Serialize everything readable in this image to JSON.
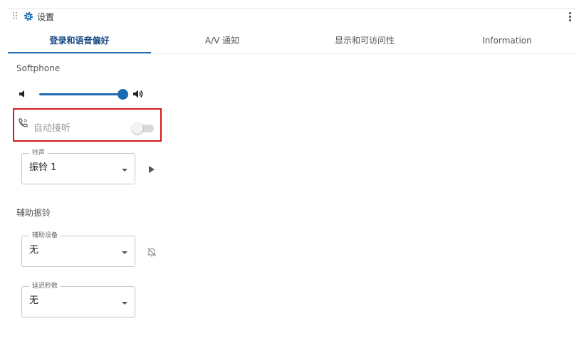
{
  "header": {
    "title": "设置",
    "more_icon": "more-vertical-icon",
    "drag_icon": "drag-handle-icon",
    "settings_icon": "gear-icon"
  },
  "tabs": [
    {
      "label": "登录和语音偏好",
      "active": true
    },
    {
      "label": "A/V 通知",
      "active": false
    },
    {
      "label": "显示和可访问性",
      "active": false
    },
    {
      "label": "Information",
      "active": false
    }
  ],
  "softphone": {
    "section_label": "Softphone",
    "volume_level": 0.94,
    "auto_answer_label": "自动接听",
    "auto_answer_enabled": false,
    "ringtone": {
      "legend": "铃声",
      "value": "振铃 1"
    }
  },
  "secondary_ring": {
    "section_label": "辅助振铃",
    "device": {
      "legend": "辅助设备",
      "value": "无"
    },
    "delay": {
      "legend": "延迟秒数",
      "value": "无"
    }
  },
  "colors": {
    "accent": "#1a6bb0",
    "highlight_border": "#d6191b"
  }
}
